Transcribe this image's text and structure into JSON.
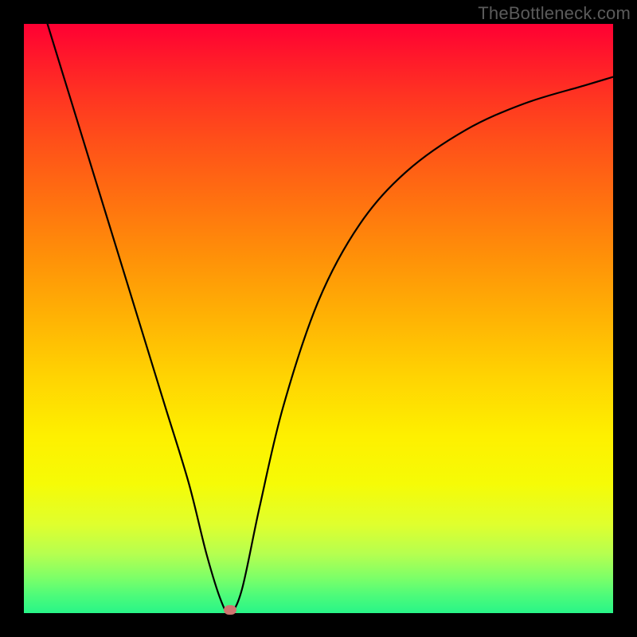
{
  "watermark": "TheBottleneck.com",
  "chart_data": {
    "type": "line",
    "title": "",
    "xlabel": "",
    "ylabel": "",
    "xlim": [
      0,
      100
    ],
    "ylim": [
      0,
      100
    ],
    "grid": false,
    "legend": {
      "position": "none"
    },
    "background_gradient": {
      "direction": "vertical",
      "stops": [
        {
          "pos": 0,
          "color": "#ff0033"
        },
        {
          "pos": 20,
          "color": "#ff5019"
        },
        {
          "pos": 40,
          "color": "#ff9208"
        },
        {
          "pos": 60,
          "color": "#ffd402"
        },
        {
          "pos": 80,
          "color": "#eeff12"
        },
        {
          "pos": 100,
          "color": "#28f588"
        }
      ]
    },
    "series": [
      {
        "name": "bottleneck-curve",
        "x": [
          4,
          8,
          12,
          16,
          20,
          24,
          28,
          31,
          33.5,
          35,
          37,
          40,
          44,
          50,
          57,
          65,
          75,
          85,
          95,
          100
        ],
        "y": [
          100,
          87,
          74,
          61,
          48,
          35,
          22,
          10,
          2,
          0,
          4,
          18,
          35,
          53,
          66,
          75,
          82,
          86.5,
          89.5,
          91
        ]
      }
    ],
    "annotations": [
      {
        "name": "min-marker",
        "x": 35,
        "y": 0.5,
        "color": "#cf7570"
      }
    ],
    "minimum": {
      "x": 35,
      "y": 0
    }
  }
}
